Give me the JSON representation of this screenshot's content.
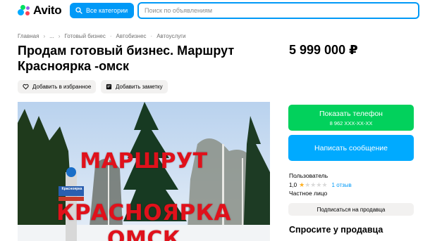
{
  "header": {
    "logo_text": "Avito",
    "categories_button": "Все категории",
    "search_placeholder": "Поиск по объявлениям"
  },
  "breadcrumb": [
    "Главная",
    "...",
    "Готовый бизнес",
    "Автобизнес",
    "Автоуслуги"
  ],
  "listing": {
    "title": "Продам готовый бизнес. Маршрут Красноярка -омск",
    "price": "5 999 000 ₽",
    "favorite_label": "Добавить в избранное",
    "note_label": "Добавить заметку",
    "photo_text": [
      "МАРШРУТ",
      "КРАСНОЯРКА",
      "ОМСК"
    ],
    "photo_sign": "Красноярка"
  },
  "contact": {
    "phone_button": "Показать телефон",
    "phone_masked": "8 962 XXX-XX-XX",
    "message_button": "Написать сообщение"
  },
  "seller": {
    "name": "Пользователь",
    "rating": "1,0",
    "stars_filled": 1,
    "stars_total": 5,
    "reviews": "1 отзыв",
    "type": "Частное лицо",
    "subscribe_button": "Подписаться на продавца"
  },
  "ask_title": "Спросите у продавца",
  "colors": {
    "accent_blue": "#0099f7",
    "phone_green": "#02d15c",
    "message_blue": "#00aaff",
    "photo_text_red": "#e0111b"
  }
}
